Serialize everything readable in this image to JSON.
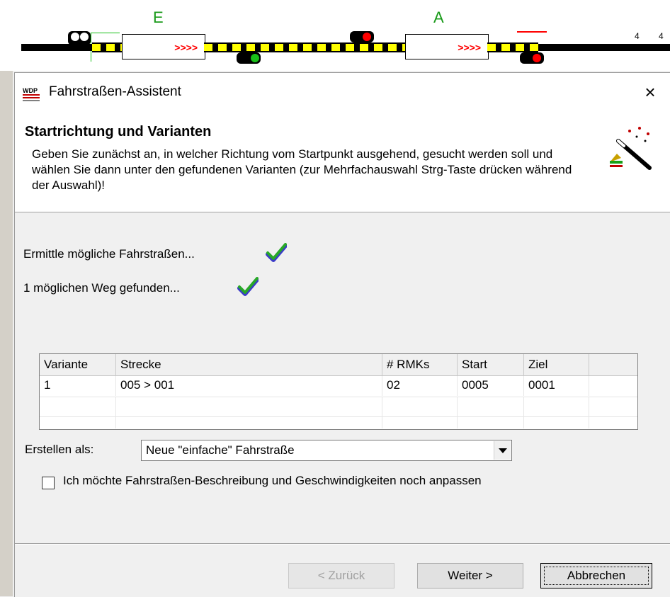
{
  "layout": {
    "signal_letters": [
      "E",
      "A"
    ],
    "block_labels": [
      ">>>>",
      ">>>>"
    ],
    "counter_labels": [
      "4",
      "4"
    ],
    "colors": {
      "track_yellow": "#ffff00",
      "signal_green": "#18c018",
      "signal_red": "#ff0000"
    }
  },
  "dialog": {
    "title": "Fahrstraßen-Assistent",
    "close_icon": "×",
    "header": {
      "title": "Startrichtung und Varianten",
      "description": "Geben Sie zunächst an, in welcher Richtung vom Startpunkt ausgehend, gesucht werden soll und wählen Sie dann unter den gefundenen Varianten (zur Mehrfachauswahl Strg-Taste drücken während der Auswahl)!"
    },
    "status": [
      {
        "text": "Ermittle mögliche Fahrstraßen...",
        "icon": "checkmark-icon"
      },
      {
        "text": "1 möglichen Weg gefunden...",
        "icon": "checkmark-icon"
      }
    ],
    "table": {
      "columns": [
        "Variante",
        "Strecke",
        "# RMKs",
        "Start",
        "Ziel"
      ],
      "rows": [
        [
          "1",
          "005 > 001",
          "02",
          "0005",
          "0001"
        ]
      ]
    },
    "create_as": {
      "label": "Erstellen als:",
      "value": "Neue \"einfache\" Fahrstraße"
    },
    "adjust_checkbox": {
      "label": "Ich möchte Fahrstraßen-Beschreibung und Geschwindigkeiten noch anpassen",
      "checked": false
    },
    "buttons": {
      "back": "< Zurück",
      "next": "Weiter >",
      "cancel": "Abbrechen"
    }
  }
}
